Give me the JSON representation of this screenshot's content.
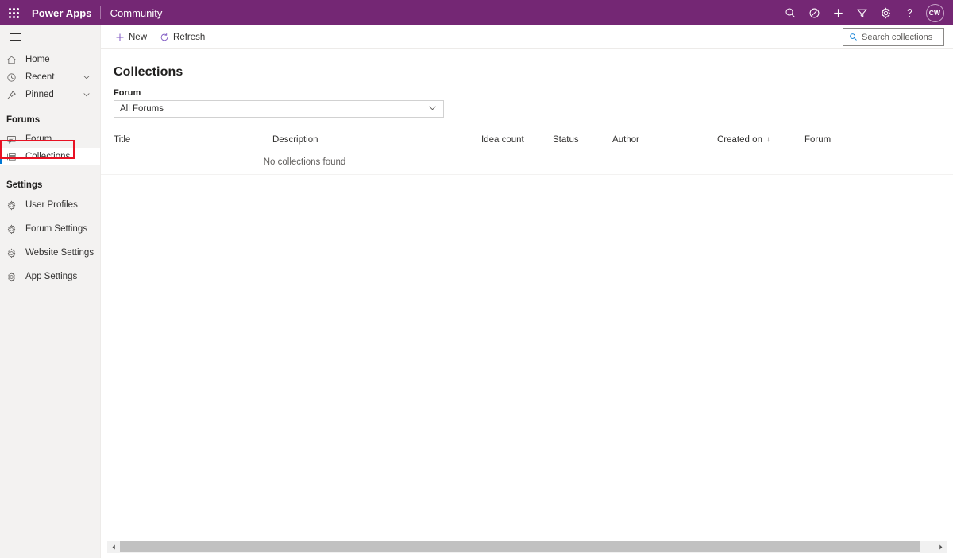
{
  "brand": {
    "waffle_icon": "app-launcher-icon",
    "title": "Power Apps",
    "app_name": "Community",
    "purple": "#742774",
    "icons": [
      {
        "name": "search-icon",
        "label": "Search"
      },
      {
        "name": "environment-icon",
        "label": "Environment"
      },
      {
        "name": "plus-icon",
        "label": "New"
      },
      {
        "name": "filter-icon",
        "label": "Filter"
      },
      {
        "name": "gear-icon",
        "label": "Settings"
      },
      {
        "name": "help-icon",
        "label": "Help"
      }
    ],
    "avatar_initials": "CW"
  },
  "sidebar": {
    "hamburger_icon": "hamburger-menu-icon",
    "items": [
      {
        "label": "Home",
        "icon": "home-icon",
        "chevron": false,
        "selected": false
      },
      {
        "label": "Recent",
        "icon": "clock-icon",
        "chevron": true,
        "selected": false
      },
      {
        "label": "Pinned",
        "icon": "pin-icon",
        "chevron": true,
        "selected": false
      }
    ],
    "groups": [
      {
        "title": "Forums",
        "items": [
          {
            "label": "Forum",
            "icon": "comment-icon",
            "selected": false
          },
          {
            "label": "Collections",
            "icon": "list-icon",
            "selected": true,
            "highlight_color": "#e81123"
          }
        ]
      },
      {
        "title": "Settings",
        "items": [
          {
            "label": "User Profiles",
            "icon": "gear-icon",
            "selected": false
          },
          {
            "label": "Forum Settings",
            "icon": "gear-icon",
            "selected": false
          },
          {
            "label": "Website Settings",
            "icon": "gear-icon",
            "selected": false
          },
          {
            "label": "App Settings",
            "icon": "gear-icon",
            "selected": false
          }
        ]
      }
    ]
  },
  "commandbar": {
    "new_label": "New",
    "new_icon": "plus-icon",
    "refresh_label": "Refresh",
    "refresh_icon": "refresh-icon",
    "accent": "#8661c5"
  },
  "search": {
    "placeholder": "Search collections",
    "icon": "search-icon",
    "value": ""
  },
  "page": {
    "title": "Collections",
    "filter_label": "Forum",
    "filter_value": "All Forums",
    "filter_chevron_icon": "chevron-down-icon"
  },
  "grid": {
    "columns": [
      {
        "label": "Title",
        "sorted": false
      },
      {
        "label": "Description",
        "sorted": false
      },
      {
        "label": "Idea count",
        "sorted": false
      },
      {
        "label": "Status",
        "sorted": false
      },
      {
        "label": "Author",
        "sorted": false
      },
      {
        "label": "Created on",
        "sorted": true,
        "sort_arrow": "↓"
      },
      {
        "label": "Forum",
        "sorted": false
      }
    ],
    "rows": [],
    "empty_message": "No collections found"
  },
  "scrollbar": {
    "left_arrow_icon": "chevron-left-icon",
    "right_arrow_icon": "chevron-right-icon"
  }
}
